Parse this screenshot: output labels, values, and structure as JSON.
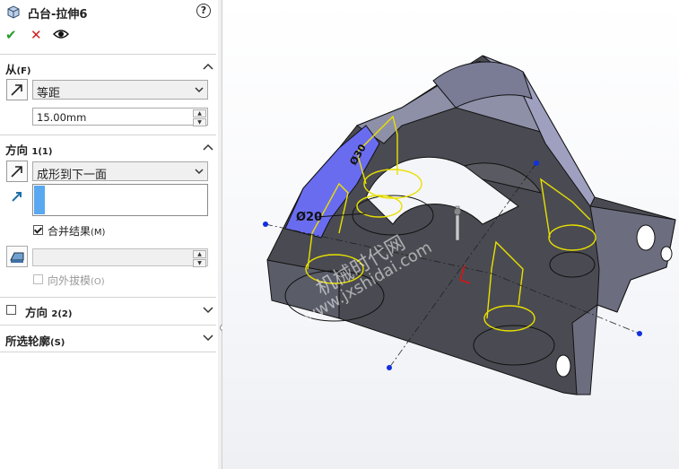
{
  "header": {
    "title": "凸台-拉伸6",
    "help": "?"
  },
  "from": {
    "title": "从",
    "key": "(F)",
    "condition": "等距",
    "distance": "15.00mm"
  },
  "direction1": {
    "title": "方向",
    "num": "1",
    "key": "(1)",
    "end_condition": "成形到下一面",
    "merge_label": "合并结果",
    "merge_key": "(M)",
    "merge_checked": true,
    "draft_label": "向外拔模",
    "draft_key": "(O)"
  },
  "direction2": {
    "title": "方向",
    "num": "2",
    "key": "(2)",
    "checked": false
  },
  "contours": {
    "title": "所选轮廓",
    "key": "(S)"
  },
  "viewport": {
    "dim1": "Ø20",
    "dim2": "Ø30",
    "watermark1": "机械时代网",
    "watermark2": "www.jxshidai.com"
  },
  "colors": {
    "accent": "#5aa8f0",
    "ok": "#2a9a2a",
    "cancel": "#d02020",
    "sketch": "#e8e000"
  }
}
